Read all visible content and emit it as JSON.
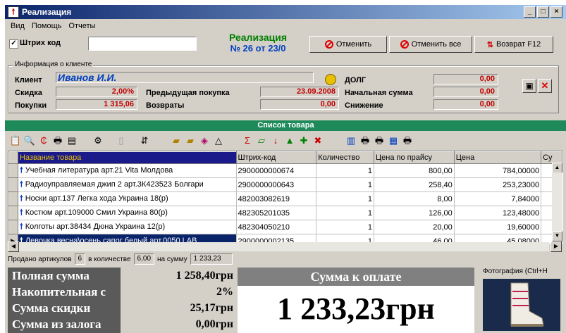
{
  "window": {
    "title": "Реализация",
    "min": "_",
    "max": "□",
    "close": "×"
  },
  "menu": [
    "Вид",
    "Помощь",
    "Отчеты"
  ],
  "barcode": {
    "label": "Штрих код",
    "value": ""
  },
  "doc": {
    "title": "Реализация",
    "number": "№ 26 от 23/0"
  },
  "buttons": {
    "cancel": "Отменить",
    "cancel_all": "Отменить все",
    "return": "Возврат F12"
  },
  "client": {
    "group_title": "Информация о клиенте",
    "client_label": "Клиент",
    "client_name": "Иванов И.И.",
    "discount_label": "Скидка",
    "discount": "2,00%",
    "purchases_label": "Покупки",
    "purchases": "1 315,06",
    "prev_purchase_label": "Предыдущая покупка",
    "prev_purchase": "23.09.2008",
    "returns_label": "Возвраты",
    "returns": "0,00",
    "debt_label": "ДОЛГ",
    "debt": "0,00",
    "initial_sum_label": "Начальная сумма",
    "initial_sum": "0,00",
    "reduction_label": "Снижение",
    "reduction": "0,00"
  },
  "list_header": "Список товара",
  "table": {
    "columns": [
      "Название товара",
      "Штрих-код",
      "Количество",
      "Цена по прайсу",
      "Цена",
      "Су"
    ],
    "rows": [
      [
        "Учебная литература арт.21 Vita Молдова",
        "2900000000674",
        "1",
        "800,00",
        "784,00000"
      ],
      [
        "Радиоуправляемая джип 2 арт.3К423523 Болгари",
        "2900000000643",
        "1",
        "258,40",
        "253,23000"
      ],
      [
        "Носки арт.137 Легка хода Украина 18(р)",
        "482003082619",
        "1",
        "8,00",
        "7,84000"
      ],
      [
        "Костюм арт.109000 Смил Украина 80(р)",
        "482305201035",
        "1",
        "126,00",
        "123,48000"
      ],
      [
        "Колготы арт.38434 Дюна Украина 12(р)",
        "482304050210",
        "1",
        "20,00",
        "19,60000"
      ],
      [
        "Девочка весна\\осень сапог белый арт.0050 LAB",
        "2900000002135",
        "1",
        "46,00",
        "45,08000"
      ]
    ]
  },
  "status": {
    "sold_label": "Продано артикулов",
    "sold": "6",
    "qty_label": "в количестве",
    "qty": "6,00",
    "sum_label": "на сумму",
    "sum": "1 233,23"
  },
  "totals": {
    "full_label": "Полная сумма",
    "full": "1 258,40грн",
    "cumulative_label": "Накопительная с",
    "cumulative": "2%",
    "discount_label": "Сумма скидки",
    "discount": "25,17грн",
    "deposit_label": "Сумма из залога",
    "deposit": "0,00грн"
  },
  "payment": {
    "label": "Сумма к оплате",
    "value": "1 233,23грн"
  },
  "photo": {
    "label": "Фотография (Ctrl+H"
  }
}
